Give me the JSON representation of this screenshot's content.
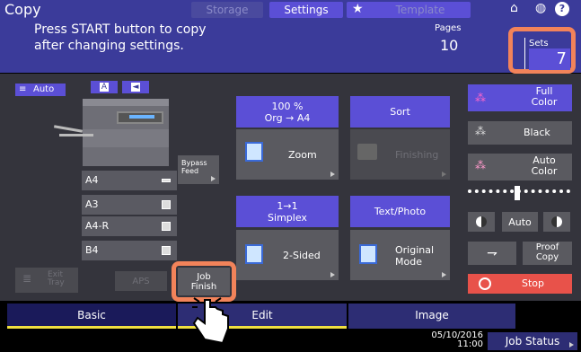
{
  "top": {
    "title": "Copy",
    "storage": "Storage",
    "settings": "Settings",
    "template": "Template"
  },
  "message": {
    "line1": "Press START button to copy",
    "line2": "after changing settings.",
    "pages_label": "Pages",
    "pages_value": "10",
    "sets_label": "Sets",
    "sets_value": "7"
  },
  "left": {
    "auto": "Auto",
    "bypass": "Bypass\nFeed",
    "papers": [
      "A4",
      "A3",
      "A4-R",
      "B4"
    ],
    "exit_tray": "Exit\nTray",
    "aps": "APS",
    "job_finish": "Job\nFinish"
  },
  "center": {
    "zoom_head": "100 %\nOrg → A4",
    "zoom": "Zoom",
    "sort_head": "Sort",
    "finishing": "Finishing",
    "simplex_head": "1→1\nSimplex",
    "two_sided": "2-Sided",
    "textphoto_head": "Text/Photo",
    "original_mode": "Original\nMode"
  },
  "right": {
    "full_color": "Full\nColor",
    "black": "Black",
    "auto_color": "Auto\nColor",
    "auto": "Auto",
    "proof": "Proof\nCopy",
    "stop": "Stop"
  },
  "tabs": {
    "basic": "Basic",
    "edit": "Edit",
    "image": "Image"
  },
  "status": {
    "date": "05/10/2016",
    "time": "11:00",
    "job_status": "Job Status"
  }
}
